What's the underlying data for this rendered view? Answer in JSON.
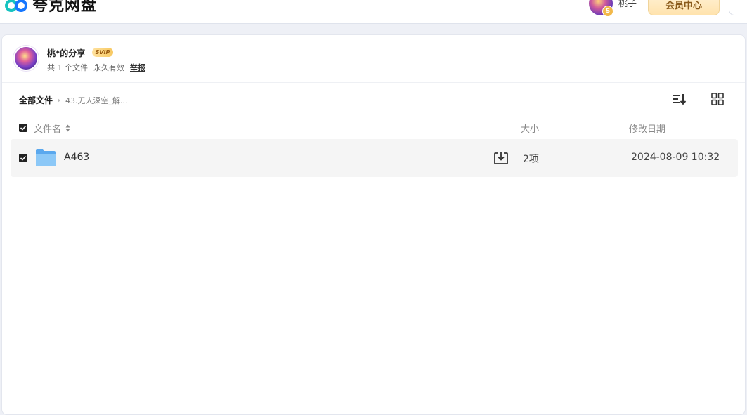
{
  "app": {
    "name": "夸克网盘",
    "username": "桃子",
    "user_badge": "S",
    "vip_center_label": "会员中心"
  },
  "share": {
    "title": "桃*的分享",
    "badge": "SVIP",
    "file_count": "共 1 个文件",
    "validity": "永久有效",
    "report_label": "举报"
  },
  "breadcrumb": {
    "root": "全部文件",
    "current": "43.无人深空_解..."
  },
  "columns": {
    "name": "文件名",
    "size": "大小",
    "date": "修改日期"
  },
  "files": [
    {
      "name": "A463",
      "type": "folder",
      "size": "2项",
      "modified": "2024-08-09 10:32",
      "checked": true
    }
  ],
  "icons": {
    "sort": "sort-list-icon",
    "grid": "grid-view-icon",
    "folder": "folder-icon",
    "save": "save-to-drive-icon"
  },
  "colors": {
    "brand_blue": "#1677ff",
    "brand_teal": "#16c3c0",
    "vip_gold": "#f7c860"
  }
}
